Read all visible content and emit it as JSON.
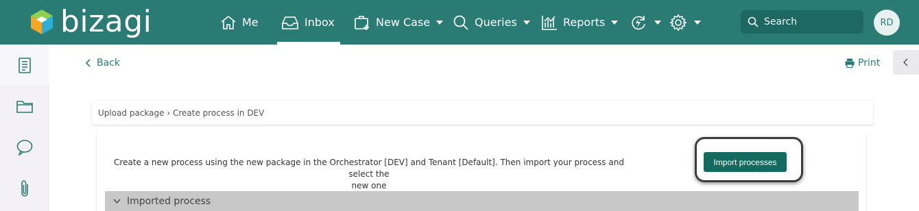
{
  "brand": {
    "name": "bizagi"
  },
  "nav": {
    "me": "Me",
    "inbox": "Inbox",
    "new_case": "New Case",
    "queries": "Queries",
    "reports": "Reports"
  },
  "search": {
    "placeholder": "Search"
  },
  "user": {
    "initials": "RD"
  },
  "toolbar": {
    "back": "Back",
    "print": "Print"
  },
  "breadcrumb": "Upload package › Create process in DEV",
  "task": {
    "instruction_line1": "Create a new process using the new package in the Orchestrator [DEV] and Tenant [Default]. Then import your process and select the",
    "instruction_line2": "new one",
    "import_button": "Import processes"
  },
  "section": {
    "title": "Imported process"
  },
  "colors": {
    "header": "#2a7b74",
    "accent": "#136b5f",
    "sidebar": "#f3f1f7"
  }
}
